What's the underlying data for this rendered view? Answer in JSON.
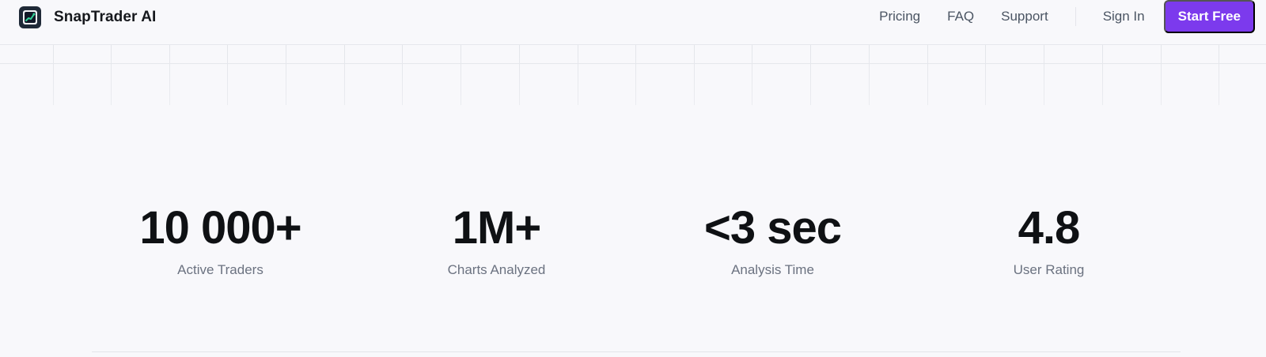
{
  "brand": {
    "name": "SnapTrader AI",
    "logo_icon": "chart-logo-icon"
  },
  "nav": {
    "links": [
      "Pricing",
      "FAQ",
      "Support"
    ],
    "sign_in": "Sign In",
    "cta": "Start Free"
  },
  "colors": {
    "accent": "#7c3aed",
    "background": "#f8f8fb",
    "text_muted": "#6b7280"
  },
  "stats": [
    {
      "value": "10 000+",
      "label": "Active Traders"
    },
    {
      "value": "1M+",
      "label": "Charts Analyzed"
    },
    {
      "value": "<3 sec",
      "label": "Analysis Time"
    },
    {
      "value": "4.8",
      "label": "User Rating"
    }
  ]
}
